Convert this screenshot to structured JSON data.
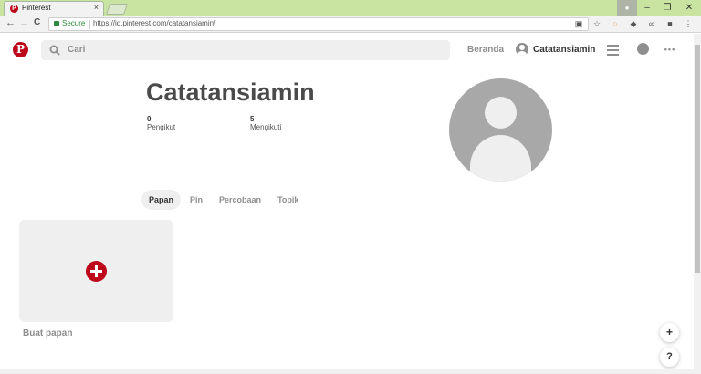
{
  "browser": {
    "tab_title": "Pinterest",
    "tab_close": "×",
    "secure_label": "Secure",
    "url": "https://id.pinterest.com/catatansiamin/",
    "back": "←",
    "forward": "→",
    "reload": "C"
  },
  "header": {
    "logo": "P",
    "search_placeholder": "Cari",
    "home_label": "Beranda",
    "username": "Catatansiamin",
    "more": "•••"
  },
  "profile": {
    "name": "Catatansiamin",
    "followers_count": "0",
    "followers_label": "Pengikut",
    "following_count": "5",
    "following_label": "Mengikuti"
  },
  "tabs": [
    {
      "label": "Papan",
      "active": true
    },
    {
      "label": "Pin",
      "active": false
    },
    {
      "label": "Percobaan",
      "active": false
    },
    {
      "label": "Topik",
      "active": false
    }
  ],
  "board": {
    "create_label": "Buat papan"
  },
  "fab": {
    "add": "+",
    "help": "?"
  },
  "colors": {
    "brand": "#bd081c",
    "tabstrip": "#c9e3a1"
  }
}
